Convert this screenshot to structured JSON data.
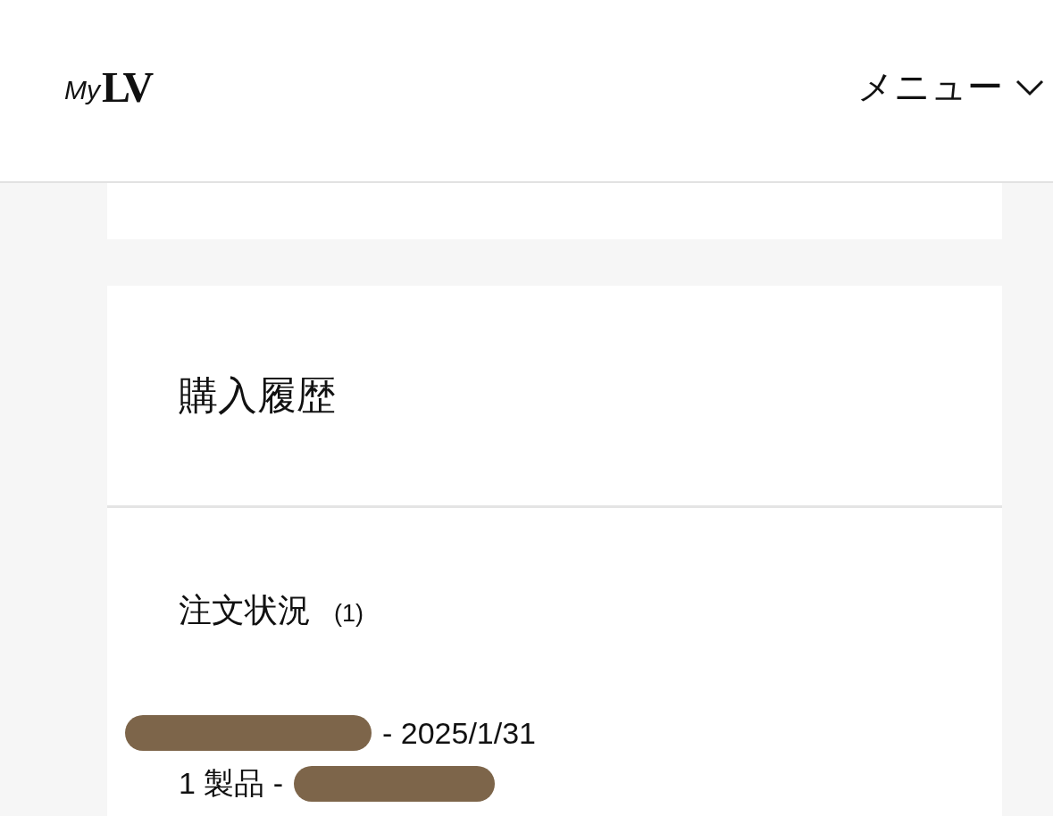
{
  "header": {
    "logo": {
      "prefix": "My",
      "monogram": "LV"
    },
    "menu": {
      "label": "メニュー",
      "expanded": false
    }
  },
  "purchase_history": {
    "title": "購入履歴",
    "order_status": {
      "title": "注文状況",
      "count": "(1)",
      "orders": [
        {
          "date_text": "- 2025/1/31",
          "summary": "1 製品 -"
        }
      ]
    }
  }
}
